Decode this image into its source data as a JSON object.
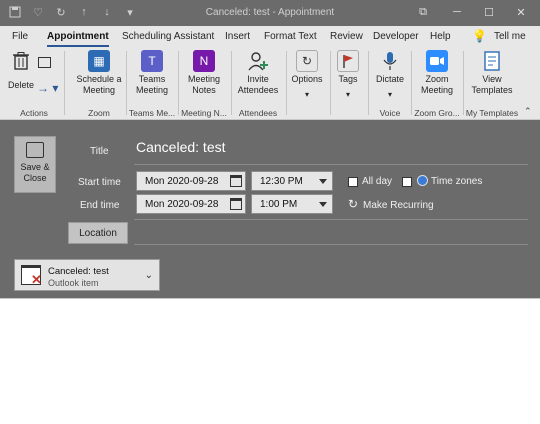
{
  "window": {
    "title": "Canceled: test  -  Appointment",
    "controls": {
      "options": "⧉",
      "minimize": "─",
      "maximize": "☐",
      "close": "✕"
    }
  },
  "quick_access": [
    {
      "name": "save-icon",
      "glyph": "💾"
    },
    {
      "name": "heart-icon",
      "glyph": "♡"
    },
    {
      "name": "redo-icon",
      "glyph": "↻"
    },
    {
      "name": "up-arrow-icon",
      "glyph": "↑"
    },
    {
      "name": "down-arrow-icon",
      "glyph": "↓"
    },
    {
      "name": "qa-more-icon",
      "glyph": "⋯"
    }
  ],
  "tabs": [
    "File",
    "Appointment",
    "Scheduling Assistant",
    "Insert",
    "Format Text",
    "Review",
    "Developer",
    "Help"
  ],
  "tell_me": "Tell me",
  "ribbon": {
    "delete": "Delete",
    "actions_group": "Actions",
    "schedule": "Schedule a Meeting",
    "zoom_group": "Zoom",
    "teams": "Teams Meeting",
    "teams_group": "Teams Me...",
    "meeting_notes": "Meeting Notes",
    "meeting_notes_group": "Meeting N...",
    "invite": "Invite Attendees",
    "attendees_group": "Attendees",
    "options": "Options",
    "tags": "Tags",
    "dictate": "Dictate",
    "voice_group": "Voice",
    "zoom_meeting": "Zoom Meeting",
    "zoom_gro_group": "Zoom Gro...",
    "view_templates": "View Templates",
    "my_templates_group": "My Templates"
  },
  "form": {
    "save_close": "Save & Close",
    "title_label": "Title",
    "title_value": "Canceled: test",
    "start_label": "Start time",
    "start_date": "Mon 2020-09-28",
    "start_time": "12:30 PM",
    "end_label": "End time",
    "end_date": "Mon 2020-09-28",
    "end_time": "1:00 PM",
    "all_day": "All day",
    "time_zones": "Time zones",
    "make_recurring": "Make Recurring",
    "location": "Location",
    "attachment_name": "Canceled: test",
    "attachment_type": "Outlook item"
  },
  "colors": {
    "accent": "#2b5797",
    "titlebar": "#6b6b6b",
    "form_bg": "#6b6b6b",
    "ribbon_bg": "#e7e7e7"
  }
}
